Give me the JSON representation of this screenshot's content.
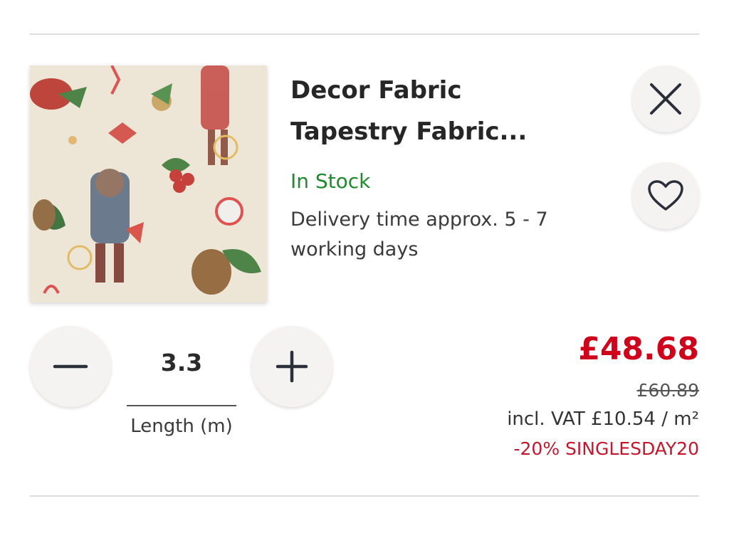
{
  "product": {
    "title_line1": "Decor Fabric",
    "title_line2": "Tapestry Fabric...",
    "stock_status": "In Stock",
    "delivery_text": "Delivery time approx. 5 - 7 working days",
    "image_icon": "fabric-thumbnail"
  },
  "actions": {
    "remove_icon": "close-icon",
    "wishlist_icon": "heart-icon"
  },
  "quantity": {
    "value": "3.3",
    "label": "Length (m)",
    "decrease_icon": "minus-icon",
    "increase_icon": "plus-icon"
  },
  "pricing": {
    "price": "£48.68",
    "old_price": "£60.89",
    "vat_text": "incl. VAT £10.54 / m²",
    "promo_text": "-20% SINGLESDAY20"
  },
  "colors": {
    "price": "#d0021b",
    "stock": "#1f8a2e",
    "promo": "#c5162e"
  }
}
